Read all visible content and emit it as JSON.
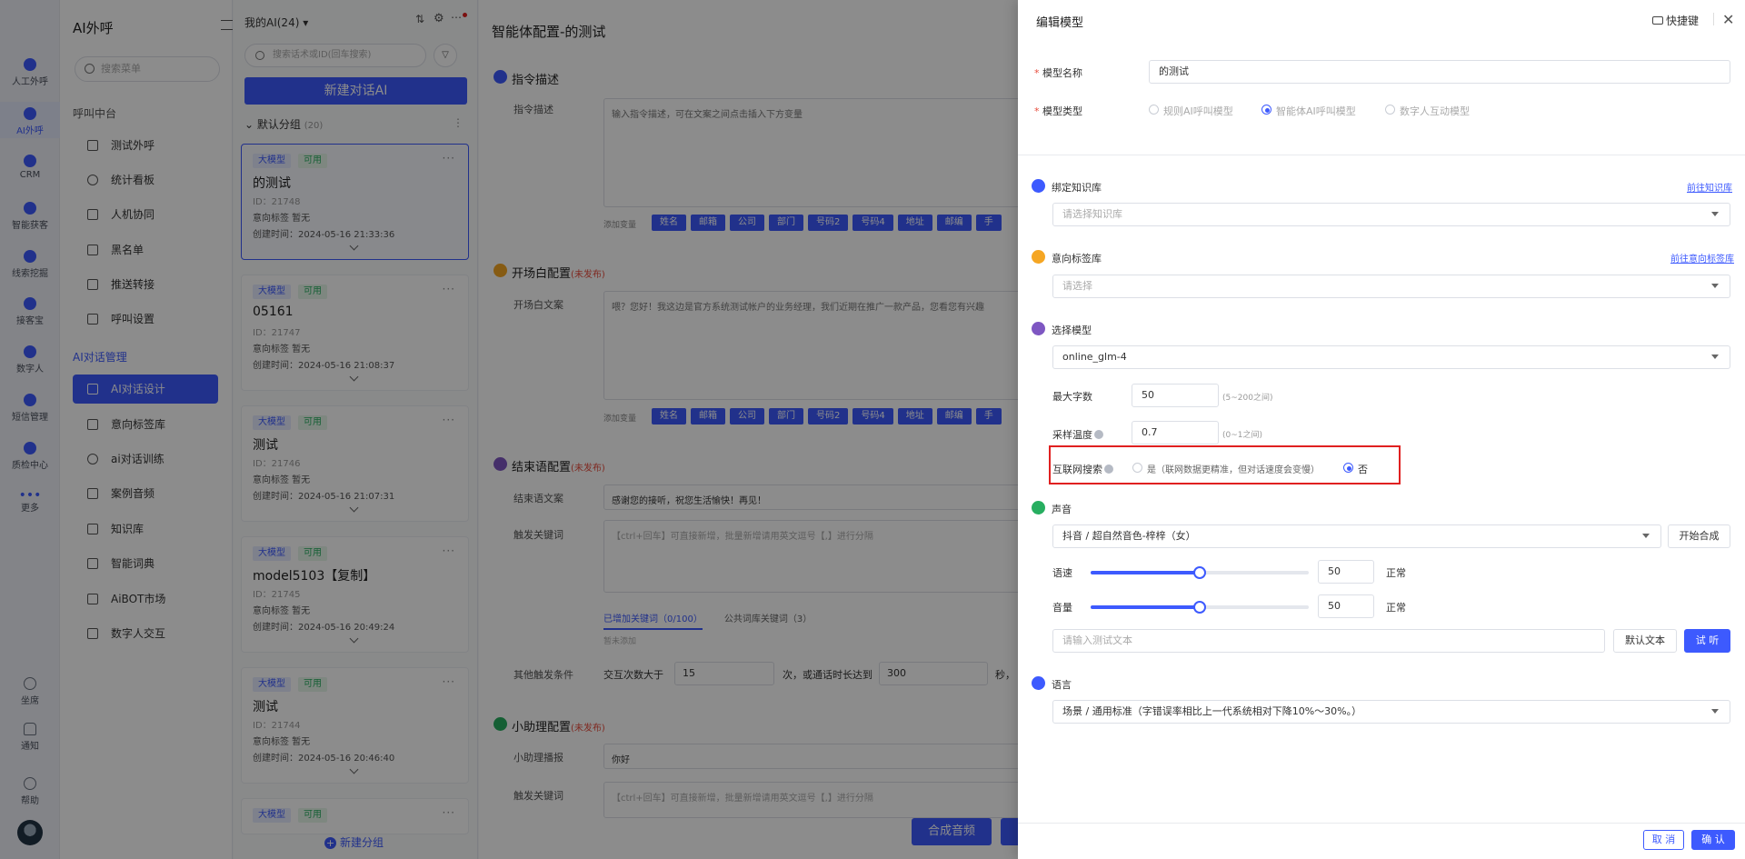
{
  "rail": {
    "items": [
      {
        "label": "人工外呼"
      },
      {
        "label": "AI外呼"
      },
      {
        "label": "CRM"
      },
      {
        "label": "智能获客"
      },
      {
        "label": "线索挖掘"
      },
      {
        "label": "接客宝"
      },
      {
        "label": "数字人"
      },
      {
        "label": "短信管理"
      },
      {
        "label": "质检中心"
      },
      {
        "label": "更多"
      },
      {
        "label": "坐席"
      },
      {
        "label": "通知"
      },
      {
        "label": "帮助"
      }
    ]
  },
  "sidebar": {
    "title": "AI外呼",
    "search_placeholder": "搜索菜单",
    "group1": "呼叫中台",
    "items1": [
      {
        "label": "测试外呼"
      },
      {
        "label": "统计看板"
      },
      {
        "label": "人机协同"
      },
      {
        "label": "黑名单"
      },
      {
        "label": "推送转接"
      },
      {
        "label": "呼叫设置"
      }
    ],
    "group2": "AI对话管理",
    "items2": [
      {
        "label": "AI对话设计"
      },
      {
        "label": "意向标签库"
      },
      {
        "label": "ai对话训练"
      },
      {
        "label": "案例音频"
      },
      {
        "label": "知识库"
      },
      {
        "label": "智能词典"
      },
      {
        "label": "AiBOT市场"
      },
      {
        "label": "数字人交互"
      }
    ]
  },
  "list": {
    "header": "我的AI(24)",
    "search_placeholder": "搜索话术或ID(回车搜索)",
    "new_button": "新建对话AI",
    "group": "默认分组",
    "group_count": "(20)",
    "tag_big": "大模型",
    "tag_ok": "可用",
    "cards": [
      {
        "name": "的测试",
        "id": "ID：21748",
        "intent": "意向标签   暂无",
        "time": "创建时间：2024-05-16 21:33:36"
      },
      {
        "name": "05161",
        "id": "ID：21747",
        "intent": "意向标签   暂无",
        "time": "创建时间：2024-05-16 21:08:37"
      },
      {
        "name": "测试",
        "id": "ID：21746",
        "intent": "意向标签   暂无",
        "time": "创建时间：2024-05-16 21:07:31"
      },
      {
        "name": "model5103【复制】",
        "id": "ID：21745",
        "intent": "意向标签   暂无",
        "time": "创建时间：2024-05-16 20:49:24"
      },
      {
        "name": "测试",
        "id": "ID：21744",
        "intent": "意向标签   暂无",
        "time": "创建时间：2024-05-16 20:46:40"
      }
    ],
    "add_group": "新建分组"
  },
  "main": {
    "title": "智能体配置-的测试",
    "sec1": "指令描述",
    "sec1_label": "指令描述",
    "sec1_text": "输入指令描述，可在文案之间点击插入下方变量",
    "add_var": "添加变量",
    "vars": [
      "姓名",
      "邮箱",
      "公司",
      "部门",
      "号码2",
      "号码4",
      "地址",
      "邮编",
      "手"
    ],
    "sec2": "开场白配置",
    "unpublished": "(未发布)",
    "sec2_label": "开场白文案",
    "sec2_text": "喂？您好！我这边是官方系统测试帐户的业务经理，我们近期在推广一款产品，您看您有兴趣",
    "sec3": "结束语配置",
    "sec3_label": "结束语文案",
    "sec3_text": "感谢您的接听，祝您生活愉快！再见！",
    "trigger_label": "触发关键词",
    "trigger_placeholder": "【ctrl+回车】可直接新增，批量新增请用英文逗号【,】进行分隔",
    "tab_added": "已增加关键词（0/100）",
    "tab_public": "公共词库关键词（3）",
    "no_add": "暂未添加",
    "other_label": "其他触发条件",
    "cond_a": "交互次数大于",
    "cond_a_val": "15",
    "cond_b": "次，或通话时长达到",
    "cond_b_val": "300",
    "cond_c": "秒，",
    "sec4": "小助理配置",
    "sec4_label": "小助理播报",
    "sec4_val": "你好",
    "sec4_trigger": "触发关键词",
    "synth_button": "合成音频"
  },
  "drawer": {
    "title": "编辑模型",
    "shortcut": "快捷键",
    "name_label": "模型名称",
    "name_value": "的测试",
    "type_label": "模型类型",
    "type_options": [
      "规则AI呼叫模型",
      "智能体AI呼叫模型",
      "数字人互动模型"
    ],
    "kb_head": "绑定知识库",
    "kb_link": "前往知识库",
    "kb_placeholder": "请选择知识库",
    "tag_head": "意向标签库",
    "tag_link": "前往意向标签库",
    "tag_placeholder": "请选择",
    "model_head": "选择模型",
    "model_value": "online_glm-4",
    "max_label": "最大字数",
    "max_value": "50",
    "max_hint": "(5~200之间)",
    "temp_label": "采样温度",
    "temp_value": "0.7",
    "temp_hint": "(0~1之间)",
    "web_label": "互联网搜索",
    "web_yes": "是（联网数据更精准，但对话速度会变慢）",
    "web_no": "否",
    "voice_head": "声音",
    "voice_value": "抖音 / 超自然音色-梓梓（女）",
    "start_synth": "开始合成",
    "speed_label": "语速",
    "speed_value": "50",
    "speed_state": "正常",
    "volume_label": "音量",
    "volume_value": "50",
    "volume_state": "正常",
    "test_placeholder": "请输入测试文本",
    "default_text": "默认文本",
    "try_listen": "试 听",
    "lang_head": "语言",
    "lang_value": "场景 / 通用标准（字错误率相比上一代系统相对下降10%～30%。）",
    "cancel": "取 消",
    "confirm": "确 认"
  },
  "colors": {
    "accent": "#3d5afe",
    "highlight": "#e02020"
  },
  "sliders": {
    "speed": 0.5,
    "volume": 0.5
  }
}
